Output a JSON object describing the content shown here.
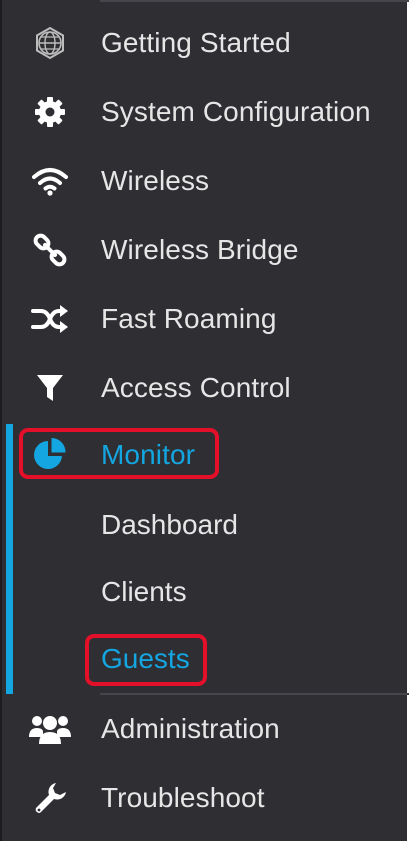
{
  "nav": {
    "items": [
      {
        "label": "Getting Started",
        "icon": "globe-icon"
      },
      {
        "label": "System Configuration",
        "icon": "gear-icon"
      },
      {
        "label": "Wireless",
        "icon": "wifi-icon"
      },
      {
        "label": "Wireless Bridge",
        "icon": "link-icon"
      },
      {
        "label": "Fast Roaming",
        "icon": "shuffle-icon"
      },
      {
        "label": "Access Control",
        "icon": "filter-icon"
      },
      {
        "label": "Monitor",
        "icon": "pie-chart-icon",
        "active": true
      },
      {
        "label": "Administration",
        "icon": "users-icon"
      },
      {
        "label": "Troubleshoot",
        "icon": "wrench-icon"
      }
    ],
    "monitor_subitems": [
      {
        "label": "Dashboard"
      },
      {
        "label": "Clients"
      },
      {
        "label": "Guests",
        "active": true
      }
    ]
  },
  "colors": {
    "sidebar_bg": "#2e2e33",
    "text": "#e6e6e6",
    "accent": "#14a6e0",
    "highlight": "#e4102a"
  }
}
